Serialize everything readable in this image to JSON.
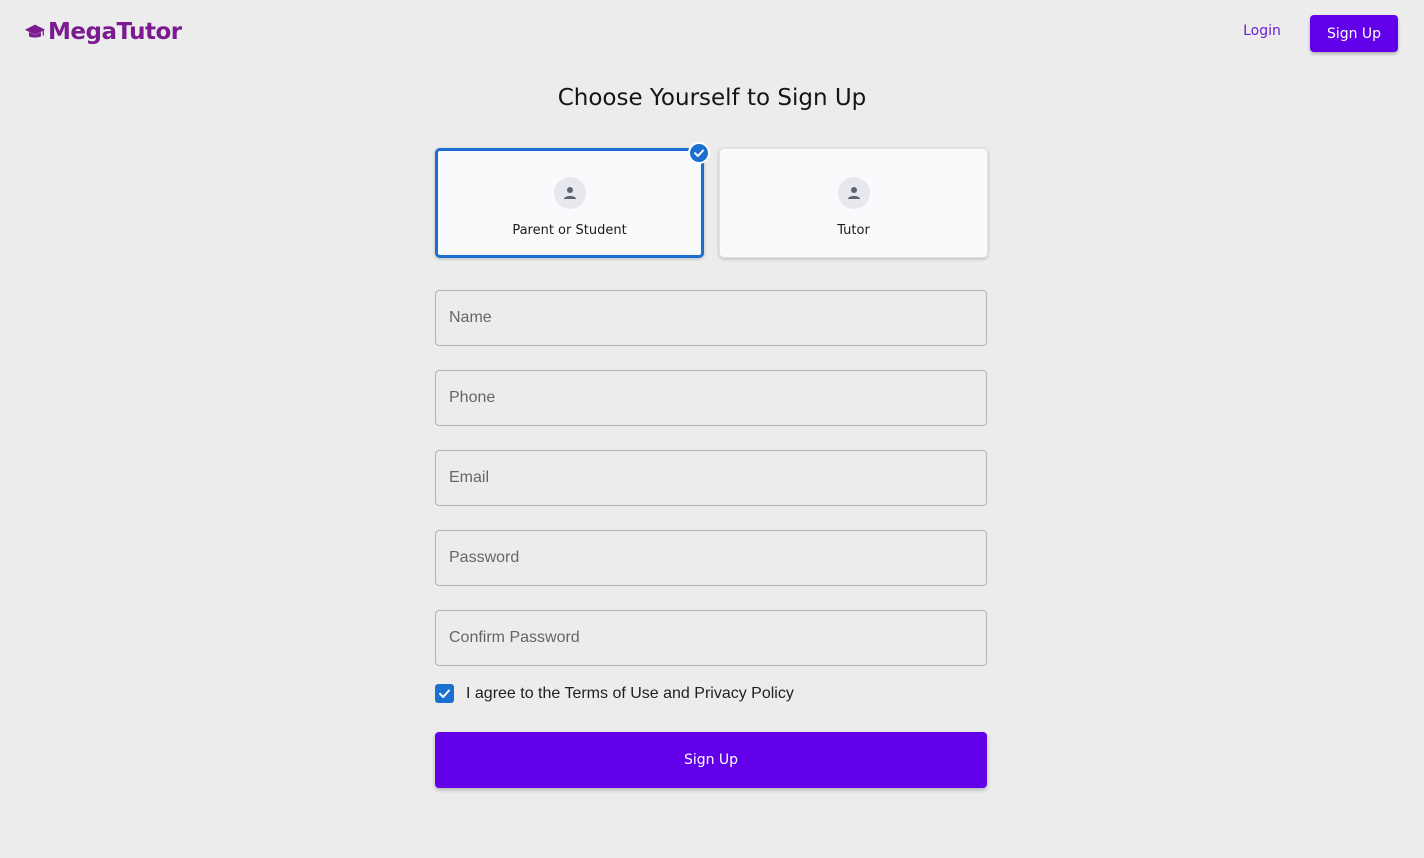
{
  "header": {
    "logo_text": "MegaTutor",
    "login_label": "Login",
    "signup_label": "Sign Up"
  },
  "page": {
    "title": "Choose Yourself to Sign Up"
  },
  "roles": [
    {
      "label": "Parent or Student",
      "selected": true,
      "icon": "person-icon"
    },
    {
      "label": "Tutor",
      "selected": false,
      "icon": "person-icon"
    }
  ],
  "form": {
    "name_placeholder": "Name",
    "phone_placeholder": "Phone",
    "email_placeholder": "Email",
    "password_placeholder": "Password",
    "confirm_password_placeholder": "Confirm Password",
    "terms_label": "I agree to the Terms of Use and Privacy Policy",
    "terms_checked": true,
    "submit_label": "Sign Up"
  },
  "colors": {
    "brand": "#7b1b8f",
    "primary": "#6200ea",
    "selected": "#1b6fd0",
    "background": "#ececec"
  }
}
